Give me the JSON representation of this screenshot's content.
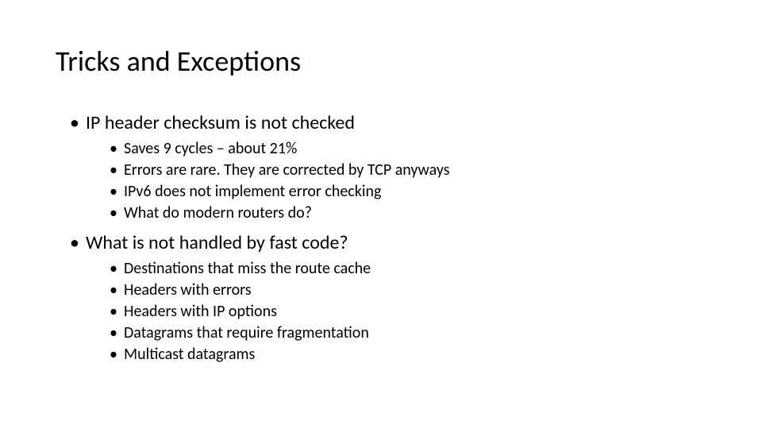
{
  "title": "Tricks and Exceptions",
  "bullets": [
    {
      "text": "IP header checksum is not checked",
      "sub": [
        "Saves 9 cycles – about 21%",
        "Errors are rare. They are corrected by TCP anyways",
        "IPv6 does not implement error checking",
        "What do modern routers do?"
      ]
    },
    {
      "text": "What is not handled by fast code?",
      "sub": [
        "Destinations that miss the route cache",
        "Headers with errors",
        "Headers with IP options",
        "Datagrams that require fragmentation",
        "Multicast datagrams"
      ]
    }
  ]
}
